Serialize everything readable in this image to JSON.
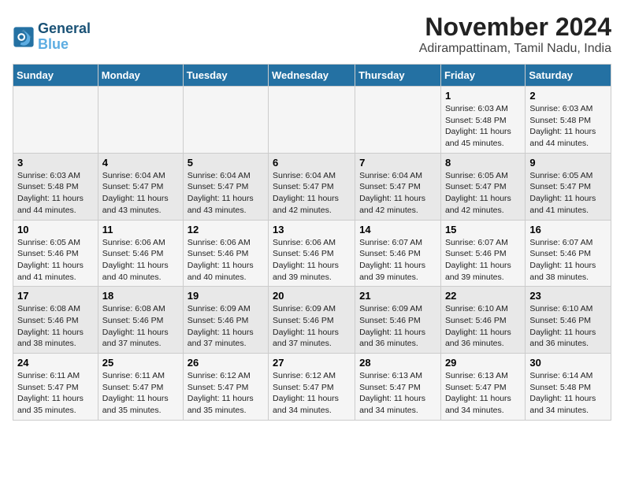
{
  "logo": {
    "line1": "General",
    "line2": "Blue"
  },
  "title": "November 2024",
  "location": "Adirampattinam, Tamil Nadu, India",
  "header_days": [
    "Sunday",
    "Monday",
    "Tuesday",
    "Wednesday",
    "Thursday",
    "Friday",
    "Saturday"
  ],
  "weeks": [
    [
      {
        "day": "",
        "detail": ""
      },
      {
        "day": "",
        "detail": ""
      },
      {
        "day": "",
        "detail": ""
      },
      {
        "day": "",
        "detail": ""
      },
      {
        "day": "",
        "detail": ""
      },
      {
        "day": "1",
        "detail": "Sunrise: 6:03 AM\nSunset: 5:48 PM\nDaylight: 11 hours and 45 minutes."
      },
      {
        "day": "2",
        "detail": "Sunrise: 6:03 AM\nSunset: 5:48 PM\nDaylight: 11 hours and 44 minutes."
      }
    ],
    [
      {
        "day": "3",
        "detail": "Sunrise: 6:03 AM\nSunset: 5:48 PM\nDaylight: 11 hours and 44 minutes."
      },
      {
        "day": "4",
        "detail": "Sunrise: 6:04 AM\nSunset: 5:47 PM\nDaylight: 11 hours and 43 minutes."
      },
      {
        "day": "5",
        "detail": "Sunrise: 6:04 AM\nSunset: 5:47 PM\nDaylight: 11 hours and 43 minutes."
      },
      {
        "day": "6",
        "detail": "Sunrise: 6:04 AM\nSunset: 5:47 PM\nDaylight: 11 hours and 42 minutes."
      },
      {
        "day": "7",
        "detail": "Sunrise: 6:04 AM\nSunset: 5:47 PM\nDaylight: 11 hours and 42 minutes."
      },
      {
        "day": "8",
        "detail": "Sunrise: 6:05 AM\nSunset: 5:47 PM\nDaylight: 11 hours and 42 minutes."
      },
      {
        "day": "9",
        "detail": "Sunrise: 6:05 AM\nSunset: 5:47 PM\nDaylight: 11 hours and 41 minutes."
      }
    ],
    [
      {
        "day": "10",
        "detail": "Sunrise: 6:05 AM\nSunset: 5:46 PM\nDaylight: 11 hours and 41 minutes."
      },
      {
        "day": "11",
        "detail": "Sunrise: 6:06 AM\nSunset: 5:46 PM\nDaylight: 11 hours and 40 minutes."
      },
      {
        "day": "12",
        "detail": "Sunrise: 6:06 AM\nSunset: 5:46 PM\nDaylight: 11 hours and 40 minutes."
      },
      {
        "day": "13",
        "detail": "Sunrise: 6:06 AM\nSunset: 5:46 PM\nDaylight: 11 hours and 39 minutes."
      },
      {
        "day": "14",
        "detail": "Sunrise: 6:07 AM\nSunset: 5:46 PM\nDaylight: 11 hours and 39 minutes."
      },
      {
        "day": "15",
        "detail": "Sunrise: 6:07 AM\nSunset: 5:46 PM\nDaylight: 11 hours and 39 minutes."
      },
      {
        "day": "16",
        "detail": "Sunrise: 6:07 AM\nSunset: 5:46 PM\nDaylight: 11 hours and 38 minutes."
      }
    ],
    [
      {
        "day": "17",
        "detail": "Sunrise: 6:08 AM\nSunset: 5:46 PM\nDaylight: 11 hours and 38 minutes."
      },
      {
        "day": "18",
        "detail": "Sunrise: 6:08 AM\nSunset: 5:46 PM\nDaylight: 11 hours and 37 minutes."
      },
      {
        "day": "19",
        "detail": "Sunrise: 6:09 AM\nSunset: 5:46 PM\nDaylight: 11 hours and 37 minutes."
      },
      {
        "day": "20",
        "detail": "Sunrise: 6:09 AM\nSunset: 5:46 PM\nDaylight: 11 hours and 37 minutes."
      },
      {
        "day": "21",
        "detail": "Sunrise: 6:09 AM\nSunset: 5:46 PM\nDaylight: 11 hours and 36 minutes."
      },
      {
        "day": "22",
        "detail": "Sunrise: 6:10 AM\nSunset: 5:46 PM\nDaylight: 11 hours and 36 minutes."
      },
      {
        "day": "23",
        "detail": "Sunrise: 6:10 AM\nSunset: 5:46 PM\nDaylight: 11 hours and 36 minutes."
      }
    ],
    [
      {
        "day": "24",
        "detail": "Sunrise: 6:11 AM\nSunset: 5:47 PM\nDaylight: 11 hours and 35 minutes."
      },
      {
        "day": "25",
        "detail": "Sunrise: 6:11 AM\nSunset: 5:47 PM\nDaylight: 11 hours and 35 minutes."
      },
      {
        "day": "26",
        "detail": "Sunrise: 6:12 AM\nSunset: 5:47 PM\nDaylight: 11 hours and 35 minutes."
      },
      {
        "day": "27",
        "detail": "Sunrise: 6:12 AM\nSunset: 5:47 PM\nDaylight: 11 hours and 34 minutes."
      },
      {
        "day": "28",
        "detail": "Sunrise: 6:13 AM\nSunset: 5:47 PM\nDaylight: 11 hours and 34 minutes."
      },
      {
        "day": "29",
        "detail": "Sunrise: 6:13 AM\nSunset: 5:47 PM\nDaylight: 11 hours and 34 minutes."
      },
      {
        "day": "30",
        "detail": "Sunrise: 6:14 AM\nSunset: 5:48 PM\nDaylight: 11 hours and 34 minutes."
      }
    ]
  ]
}
